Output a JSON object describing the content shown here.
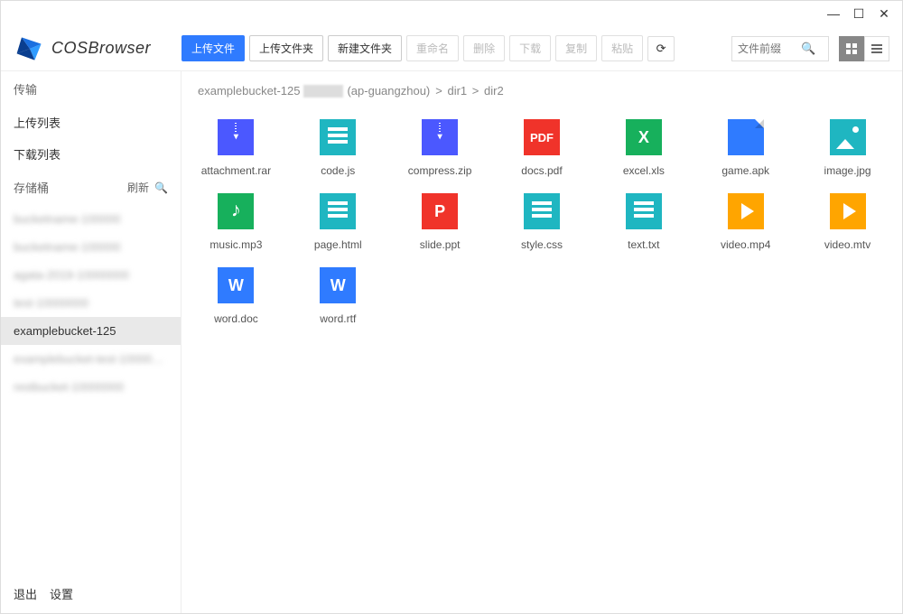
{
  "app_name": "COSBrowser",
  "window_controls": {
    "min": "—",
    "max": "☐",
    "close": "✕"
  },
  "toolbar": {
    "upload_file": "上传文件",
    "upload_folder": "上传文件夹",
    "new_folder": "新建文件夹",
    "rename": "重命名",
    "delete": "删除",
    "download": "下载",
    "copy": "复制",
    "paste": "粘贴"
  },
  "search": {
    "placeholder": "文件前缀"
  },
  "sidebar": {
    "transfer_header": "传输",
    "upload_list": "上传列表",
    "download_list": "下载列表",
    "bucket_header": "存储桶",
    "refresh": "刷新",
    "buckets": [
      {
        "label": "bucketname-100000",
        "blur": true
      },
      {
        "label": "bucketname-100000",
        "blur": true
      },
      {
        "label": "agata-2019-10000000",
        "blur": true
      },
      {
        "label": "test-10000000",
        "blur": true
      },
      {
        "label": "examplebucket-125",
        "selected": true
      },
      {
        "label": "examplebucket-test-10000000",
        "blur": true
      },
      {
        "label": "restbucket-10000000",
        "blur": true
      }
    ],
    "footer": {
      "exit": "退出",
      "settings": "设置"
    }
  },
  "breadcrumb": {
    "bucket": "examplebucket-125",
    "region": "(ap-guangzhou)",
    "parts": [
      "dir1",
      "dir2"
    ]
  },
  "files": [
    {
      "name": "attachment.rar",
      "kind": "zip",
      "color": "#4b58ff"
    },
    {
      "name": "code.js",
      "kind": "code",
      "color": "#1fb6c1"
    },
    {
      "name": "compress.zip",
      "kind": "zip",
      "color": "#4b58ff"
    },
    {
      "name": "docs.pdf",
      "kind": "pdf",
      "color": "#f0332a",
      "text": "PDF"
    },
    {
      "name": "excel.xls",
      "kind": "letter",
      "color": "#17b05c",
      "text": "X"
    },
    {
      "name": "game.apk",
      "kind": "apk",
      "color": "#2f7bff"
    },
    {
      "name": "image.jpg",
      "kind": "image",
      "color": "#1fb6c1"
    },
    {
      "name": "music.mp3",
      "kind": "music",
      "color": "#17b05c"
    },
    {
      "name": "page.html",
      "kind": "code",
      "color": "#1fb6c1"
    },
    {
      "name": "slide.ppt",
      "kind": "letter",
      "color": "#f0332a",
      "text": "P"
    },
    {
      "name": "style.css",
      "kind": "code",
      "color": "#1fb6c1"
    },
    {
      "name": "text.txt",
      "kind": "code",
      "color": "#1fb6c1"
    },
    {
      "name": "video.mp4",
      "kind": "video",
      "color": "#ffa500"
    },
    {
      "name": "video.mtv",
      "kind": "video",
      "color": "#ffa500"
    },
    {
      "name": "word.doc",
      "kind": "letter",
      "color": "#2f7bff",
      "text": "W"
    },
    {
      "name": "word.rtf",
      "kind": "letter",
      "color": "#2f7bff",
      "text": "W"
    }
  ]
}
